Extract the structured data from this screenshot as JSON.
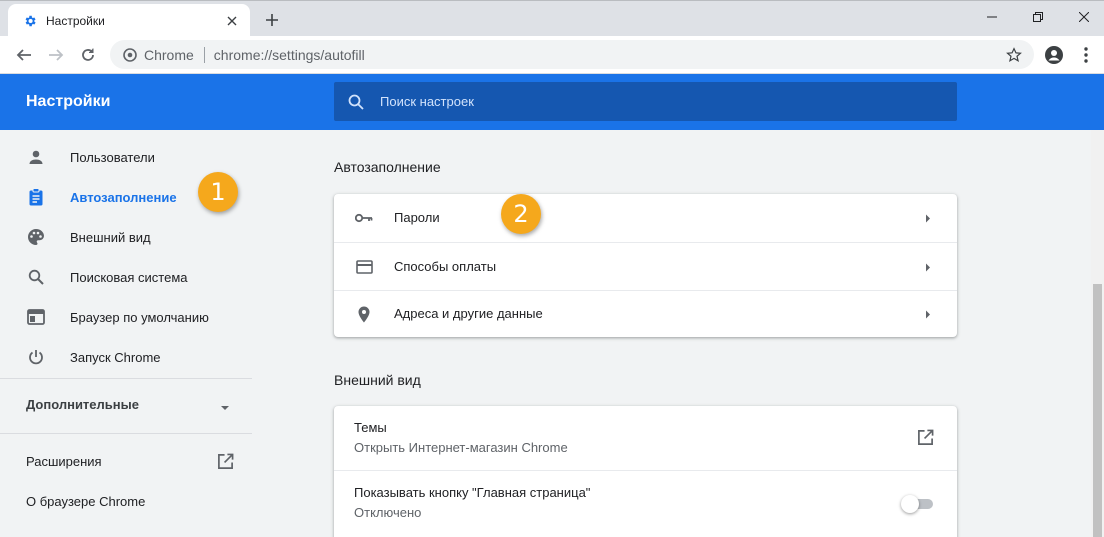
{
  "colors": {
    "accent": "#1a73e8",
    "header_bg": "#1a73e8",
    "search_bg": "#1557b0",
    "badge": "#f5a81c"
  },
  "browser": {
    "tab_title": "Настройки",
    "tab_favicon": "gear-icon",
    "omnibox_chip": "Chrome",
    "url": "chrome://settings/autofill"
  },
  "header": {
    "title": "Настройки",
    "search_placeholder": "Поиск настроек"
  },
  "sidebar": {
    "items": [
      {
        "label": "Пользователи",
        "icon": "person-icon"
      },
      {
        "label": "Автозаполнение",
        "icon": "clipboard-icon",
        "active": true
      },
      {
        "label": "Внешний вид",
        "icon": "palette-icon"
      },
      {
        "label": "Поисковая система",
        "icon": "search-icon"
      },
      {
        "label": "Браузер по умолчанию",
        "icon": "browser-icon"
      },
      {
        "label": "Запуск Chrome",
        "icon": "power-icon"
      }
    ],
    "advanced": "Дополнительные",
    "extensions": "Расширения",
    "about": "О браузере Chrome"
  },
  "autofill": {
    "title": "Автозаполнение",
    "rows": [
      {
        "label": "Пароли",
        "icon": "key-icon"
      },
      {
        "label": "Способы оплаты",
        "icon": "credit-card-icon"
      },
      {
        "label": "Адреса и другие данные",
        "icon": "location-pin-icon"
      }
    ]
  },
  "appearance": {
    "title": "Внешний вид",
    "themes_title": "Темы",
    "themes_subtitle": "Открыть Интернет-магазин Chrome",
    "home_title": "Показывать кнопку \"Главная страница\"",
    "home_subtitle": "Отключено",
    "home_enabled": false
  },
  "badges": [
    "1",
    "2"
  ]
}
